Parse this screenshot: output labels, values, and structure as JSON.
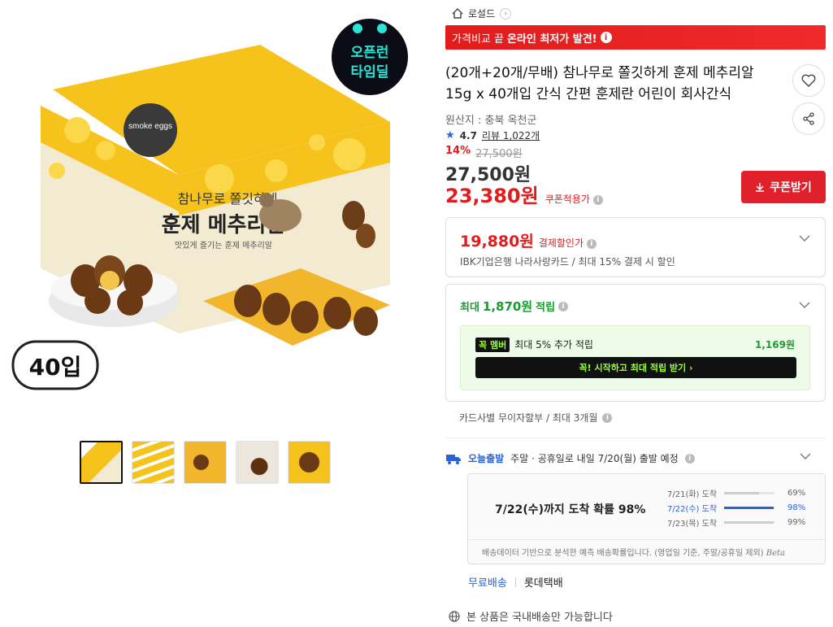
{
  "breadcrumb": {
    "label": "로설드"
  },
  "promo": {
    "prefix": "가격비교 끝",
    "highlight": "온라인 최저가 발견!"
  },
  "product": {
    "title": "(20개+20개/무배) 참나무로 쫄깃하게 훈제 메추리알 15g x 40개입 간식 간편 훈제란 어린이 회사간식",
    "origin": "원산지 : 충북 옥천군",
    "rating": "4.7",
    "review_label": "리뷰 1,022개",
    "discount_pct": "14%",
    "orig_price": "27,500원",
    "price": "27,500원",
    "coupon_price": "23,380원",
    "coupon_note": "쿠폰적용가"
  },
  "coupon_button": "쿠폰받기",
  "card_discount": {
    "amount": "19,880원",
    "label": "결제할인가",
    "detail": "IBK기업은행 나라사랑카드 / 최대 15% 결제 시 할인"
  },
  "reward": {
    "prefix": "최대",
    "amount": "1,870원",
    "suffix": "적립",
    "member_badge": "꼭 멤버",
    "member_text": "최대 5% 추가 적립",
    "member_value": "1,169원",
    "start_button": "꼭! 시작하고 최대 적립 받기  ›"
  },
  "installment": "카드사별 무이자할부 / 최대 3개월",
  "shipping": {
    "today_label": "오늘출발",
    "desc": "주말 · 공휴일로 내일 7/20(월) 출발 예정",
    "prediction": "7/22(수)까지 도착 확률 98%",
    "rows": [
      {
        "date": "7/21(화) 도착",
        "pct": "69%",
        "value": 0.69
      },
      {
        "date": "7/22(수) 도착",
        "pct": "98%",
        "value": 0.98
      },
      {
        "date": "7/23(목) 도착",
        "pct": "99%",
        "value": 0.99
      }
    ],
    "note": "배송데이터 기반으로 분석한 예측 배송확률입니다. (영업일 기준, 주말/공휴일 제외)",
    "beta": "Beta",
    "free": "무료배송",
    "carrier": "롯데택배",
    "domestic": "본 상품은 국내배송만 가능합니다"
  },
  "image": {
    "badge_line1": "오픈런",
    "badge_line2": "타임딜",
    "count_badge": "40입",
    "box_title_small": "참나무로 쫄깃하게",
    "box_title": "훈제 메추리알",
    "box_sub": "맛있게 즐기는 훈제 메추리알",
    "box_brand": "smoke eggs"
  },
  "colors": {
    "accent": "#e01c1c",
    "blue": "#2a62d8",
    "green": "#1a9c2e"
  }
}
